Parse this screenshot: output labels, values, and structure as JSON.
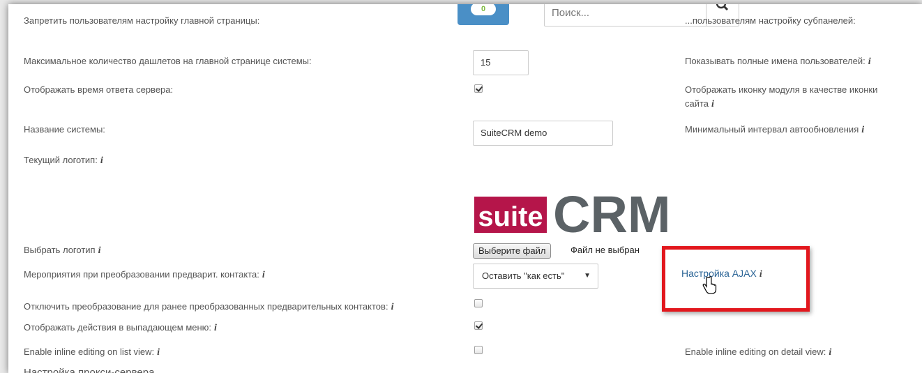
{
  "header": {
    "notify_count": "0",
    "search_placeholder": "Поиск..."
  },
  "left": {
    "row1": "Запретить пользователям настройку главной страницы:",
    "row2": "Максимальное количество дашлетов на главной странице системы:",
    "row3": "Отображать время ответа сервера:",
    "row4": "Название системы:",
    "row5": "Текущий логотип:",
    "row6": "Выбрать логотип",
    "row7": "Мероприятия при преобразовании предварит. контакта:",
    "row8": "Отключить преобразование для ранее преобразованных предварительных контактов:",
    "row9": "Отображать действия в выпадающем меню:",
    "row10": "Enable inline editing on list view:",
    "row11": "Настройка прокси-сервера"
  },
  "inputs": {
    "max_dashlets": "15",
    "system_name": "SuiteCRM demo",
    "file_button": "Выберите файл",
    "file_status": "Файл не выбран",
    "lead_conversion_selected": "Оставить \"как есть\""
  },
  "checks": {
    "show_response_time": true,
    "disable_conversion": false,
    "actions_dropdown": true,
    "inline_list": false
  },
  "right": {
    "subpanels": "...пользователям настройку субпанелей:",
    "full_names": "Показывать полные имена пользователей:",
    "module_icon": "Отображать иконку модуля в качестве иконки сайта",
    "min_refresh": "Минимальный интервал автообновления",
    "inline_detail": "Enable inline editing on detail view:"
  },
  "ajax_link": "Настройка AJAX",
  "logo": {
    "part1": "suite",
    "part2": "CRM"
  },
  "info_glyph": "i",
  "colors": {
    "link": "#2a6496",
    "highlight": "#e2171d",
    "logo_red": "#b5154a",
    "logo_gray": "#5b6266"
  }
}
